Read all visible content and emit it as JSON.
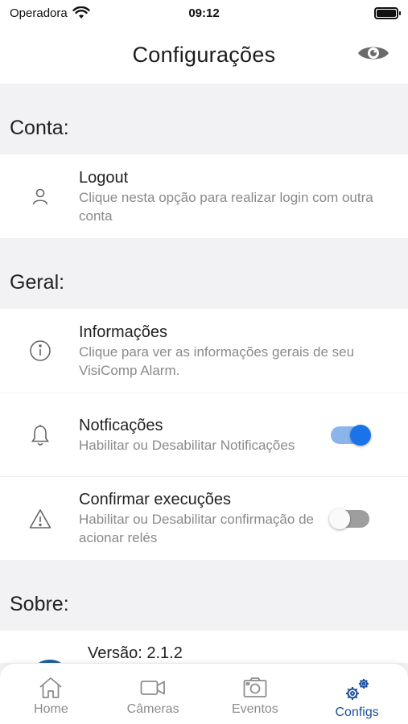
{
  "status_bar": {
    "carrier": "Operadora",
    "time": "09:12"
  },
  "header": {
    "title": "Configurações"
  },
  "sections": {
    "conta": {
      "label": "Conta:"
    },
    "geral": {
      "label": "Geral:"
    },
    "sobre": {
      "label": "Sobre:"
    }
  },
  "rows": {
    "logout": {
      "title": "Logout",
      "subtitle": "Clique nesta opção para realizar login com outra conta",
      "icon": "user-icon"
    },
    "informacoes": {
      "title": "Informações",
      "subtitle": "Clique para ver as informações gerais de seu VisiComp Alarm.",
      "icon": "info-icon"
    },
    "notificacoes": {
      "title": "Notficações",
      "subtitle": "Habilitar ou Desabilitar Notificações",
      "icon": "bell-icon",
      "enabled": true
    },
    "confirmar": {
      "title": "Confirmar execuções",
      "subtitle": "Habilitar ou Desabilitar confirmação de acionar relés",
      "icon": "warning-icon",
      "enabled": false
    },
    "versao": {
      "title": "Versão: 2.1.2"
    }
  },
  "tabs": [
    {
      "label": "Home",
      "icon": "home-icon"
    },
    {
      "label": "Câmeras",
      "icon": "camera-icon"
    },
    {
      "label": "Eventos",
      "icon": "photo-camera-icon"
    },
    {
      "label": "Configs",
      "icon": "gears-icon",
      "active": true
    }
  ],
  "colors": {
    "accent": "#1a73e8",
    "tab_active": "#1d4f9e",
    "toggle_track_on": "#8ab5ec",
    "toggle_track_off": "#9e9e9e"
  }
}
